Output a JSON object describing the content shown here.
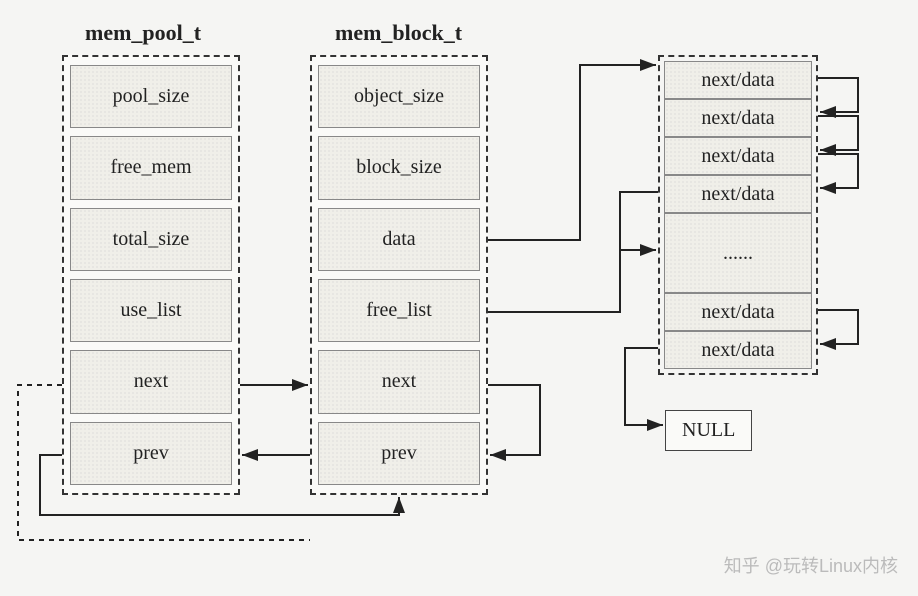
{
  "struct1": {
    "title": "mem_pool_t",
    "fields": [
      "pool_size",
      "free_mem",
      "total_size",
      "use_list",
      "next",
      "prev"
    ]
  },
  "struct2": {
    "title": "mem_block_t",
    "fields": [
      "object_size",
      "block_size",
      "data",
      "free_list",
      "next",
      "prev"
    ]
  },
  "data_nodes": {
    "top": [
      "next/data",
      "next/data",
      "next/data",
      "next/data"
    ],
    "mid_ellipsis": "......",
    "bottom": [
      "next/data",
      "next/data"
    ]
  },
  "null_label": "NULL",
  "watermark": "知乎 @玩转Linux内核"
}
